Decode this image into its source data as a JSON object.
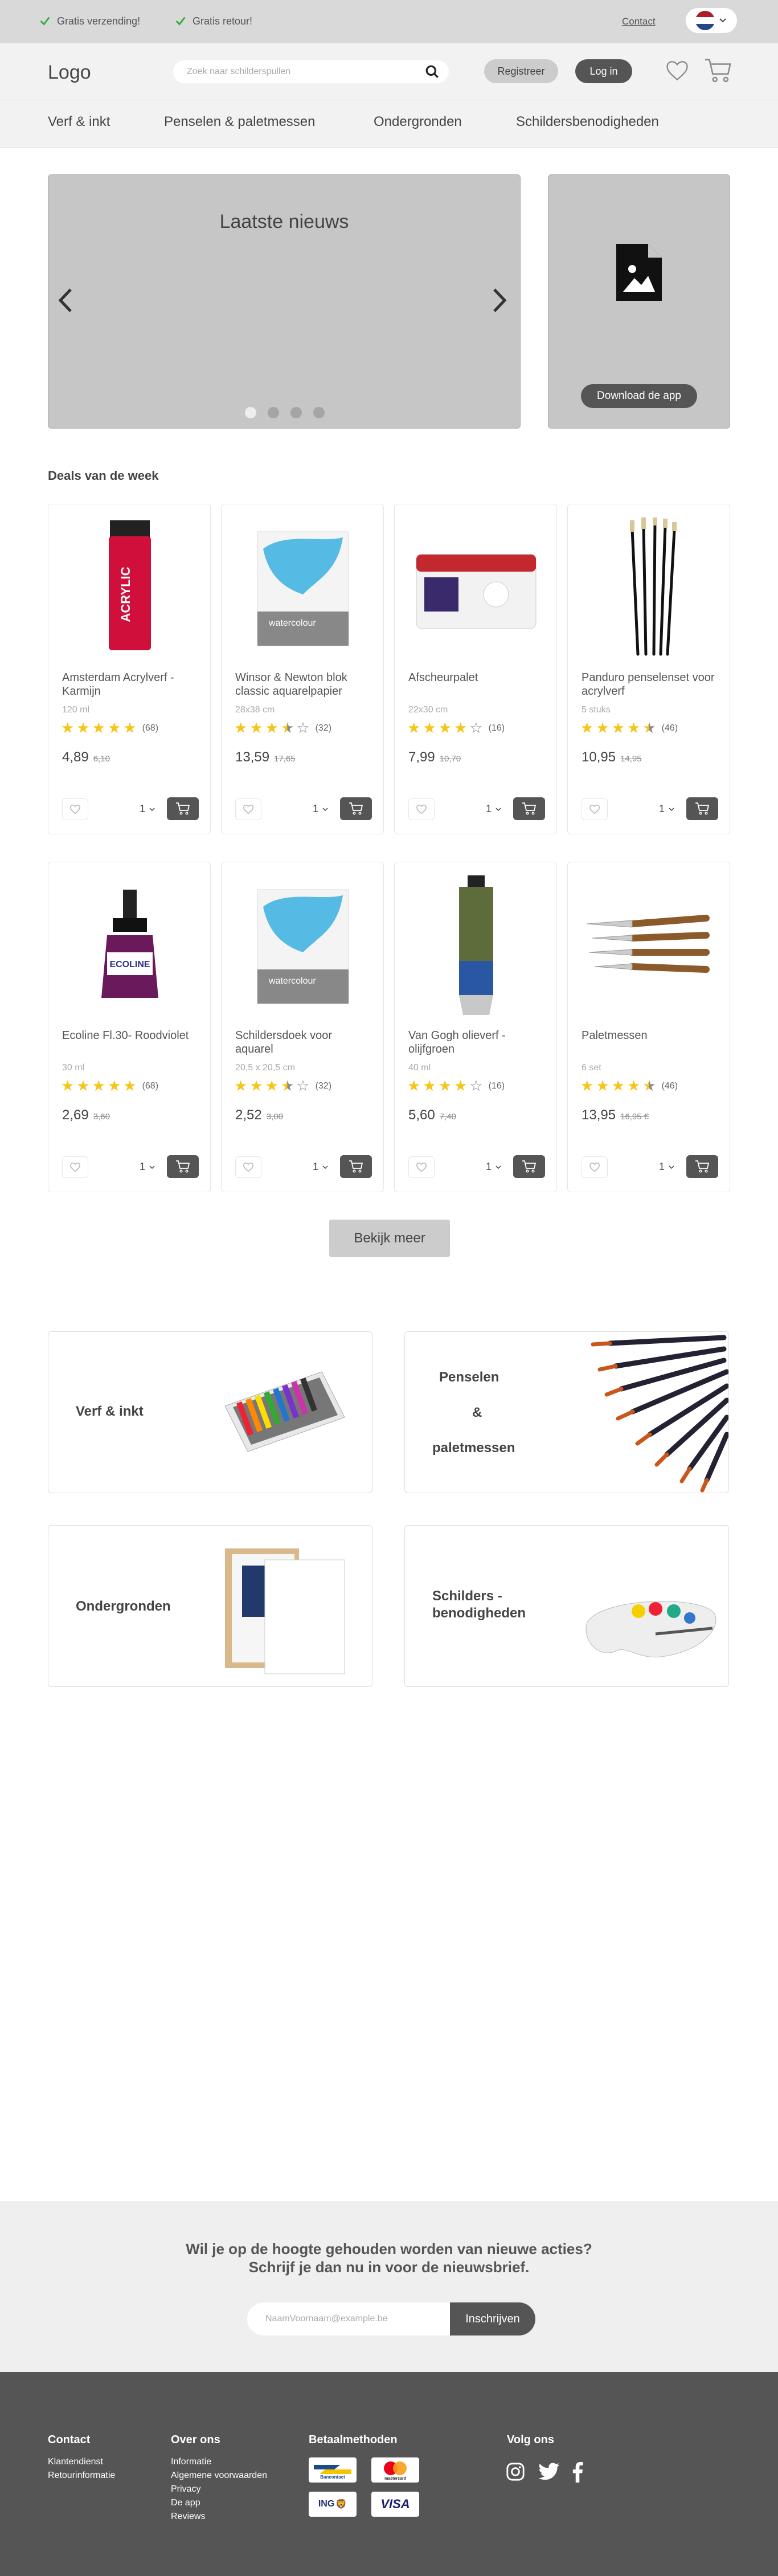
{
  "topbar": {
    "usp": [
      "Gratis verzending!",
      "Gratis retour!"
    ],
    "contact": "Contact"
  },
  "header": {
    "logo": "Logo",
    "search_placeholder": "Zoek naar schilderspullen",
    "register": "Registreer",
    "login": "Log in"
  },
  "nav": [
    "Verf & inkt",
    "Penselen & paletmessen",
    "Ondergronden",
    "Schildersbenodigheden"
  ],
  "hero": {
    "title": "Laatste nieuws",
    "app_button": "Download de app"
  },
  "deals": {
    "title": "Deals van de week",
    "products": [
      {
        "name": "Amsterdam Acrylverf - Karmijn",
        "sub": "120 ml",
        "rating": 5,
        "count": "(68)",
        "price": "4,89",
        "old": "6,10",
        "qty": "1"
      },
      {
        "name": "Winsor & Newton blok classic aquarelpapier",
        "sub": "28x38 cm",
        "rating": 3.5,
        "count": "(32)",
        "price": "13,59",
        "old": "17,65",
        "qty": "1"
      },
      {
        "name": "Afscheurpalet",
        "sub": "22x30 cm",
        "rating": 4,
        "count": "(16)",
        "price": "7,99",
        "old": "10,70",
        "qty": "1"
      },
      {
        "name": "Panduro penselenset voor acrylverf",
        "sub": "5 stuks",
        "rating": 4.5,
        "count": "(46)",
        "price": "10,95",
        "old": "14,95",
        "qty": "1"
      },
      {
        "name": "Ecoline Fl.30- Roodviolet",
        "sub": "30 ml",
        "rating": 5,
        "count": "(68)",
        "price": "2,69",
        "old": "3,60",
        "qty": "1"
      },
      {
        "name": "Schildersdoek voor aquarel",
        "sub": "20,5 x 20,5 cm",
        "rating": 3.5,
        "count": "(32)",
        "price": "2,52",
        "old": "3,00",
        "qty": "1"
      },
      {
        "name": "Van Gogh olieverf - olijfgroen",
        "sub": "40 ml",
        "rating": 4,
        "count": "(16)",
        "price": "5,60",
        "old": "7,40",
        "qty": "1"
      },
      {
        "name": "Paletmessen",
        "sub": "6 set",
        "rating": 4.5,
        "count": "(46)",
        "price": "13,95",
        "old": "16,95 €",
        "qty": "1"
      }
    ],
    "more": "Bekijk meer"
  },
  "categories": [
    "Verf & inkt",
    "Penselen",
    "&",
    "paletmessen",
    "Ondergronden",
    "Schilders -",
    "benodigheden"
  ],
  "newsletter": {
    "line1": "Wil je op de hoogte gehouden worden van nieuwe acties?",
    "line2": "Schrijf je dan nu in voor de nieuwsbrief.",
    "placeholder": "NaamVoornaam@example.be",
    "button": "Inschrijven"
  },
  "footer": {
    "contact_title": "Contact",
    "contact_links": [
      "Klantendienst",
      "Retourinformatie"
    ],
    "about_title": "Over ons",
    "about_links": [
      "Informatie",
      "Algemene voorwaarden",
      "Privacy",
      "De app",
      "Reviews"
    ],
    "pay_title": "Betaalmethoden",
    "pay": [
      "Bancontact",
      "mastercard",
      "ING",
      "VISA"
    ],
    "follow_title": "Volg ons"
  },
  "colors": {
    "dark": "#555555",
    "gray_block": "#c6c6c6",
    "star": "#f5c518",
    "check": "#2eaa3a"
  }
}
